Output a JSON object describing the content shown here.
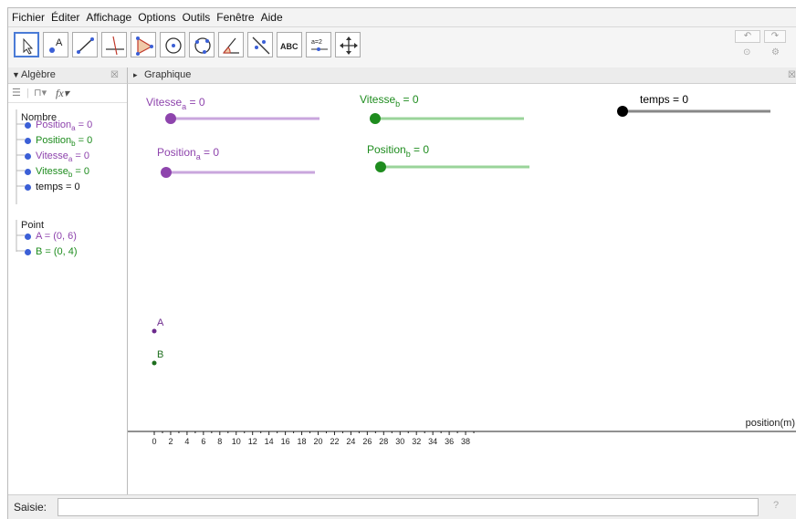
{
  "menu": [
    "Fichier",
    "Éditer",
    "Affichage",
    "Options",
    "Outils",
    "Fenêtre",
    "Aide"
  ],
  "toolbar": {
    "tools": [
      "move-tool",
      "point-tool",
      "segment-tool",
      "perpendicular-tool",
      "polygon-tool",
      "circle-tool",
      "circle-three-points-tool",
      "angle-tool",
      "reflect-tool",
      "text-tool",
      "slider-tool",
      "move-view-tool"
    ],
    "text_tool_label": "ABC",
    "slider_tool_label": "a=2",
    "undo_icon": "↶",
    "redo_icon": "↷"
  },
  "algebra": {
    "title": "Algèbre",
    "nombre_label": "Nombre",
    "point_label": "Point",
    "items": [
      {
        "base": "Position",
        "sub": "a",
        "rest": " = 0",
        "color": "#8e44ad"
      },
      {
        "base": "Position",
        "sub": "b",
        "rest": " = 0",
        "color": "#1e8c1e"
      },
      {
        "base": "Vitesse",
        "sub": "a",
        "rest": " = 0",
        "color": "#8e44ad"
      },
      {
        "base": "Vitesse",
        "sub": "b",
        "rest": " = 0",
        "color": "#1e8c1e"
      },
      {
        "base": "temps",
        "sub": "",
        "rest": " = 0",
        "color": "#111111"
      }
    ],
    "points": [
      {
        "text": "A = (0, 6)",
        "color": "#8e44ad"
      },
      {
        "text": "B = (0, 4)",
        "color": "#1e8c1e"
      }
    ]
  },
  "graphics": {
    "title": "Graphique",
    "sliders": [
      {
        "name": "Vitesse",
        "sub": "a",
        "value_text": " = 0",
        "value": 0,
        "color": "#8e44ad",
        "track": "#c9a6dd"
      },
      {
        "name": "Vitesse",
        "sub": "b",
        "value_text": " = 0",
        "value": 0,
        "color": "#1e8c1e",
        "track": "#9ad49a"
      },
      {
        "name": "temps",
        "sub": "",
        "value_text": " = 0",
        "value": 0,
        "color": "#000000",
        "track": "#888888"
      },
      {
        "name": "Position",
        "sub": "a",
        "value_text": " = 0",
        "value": 0,
        "color": "#8e44ad",
        "track": "#c9a6dd"
      },
      {
        "name": "Position",
        "sub": "b",
        "value_text": " = 0",
        "value": 0,
        "color": "#1e8c1e",
        "track": "#9ad49a"
      }
    ],
    "points": [
      {
        "label": "A",
        "color": "#6c2a8c"
      },
      {
        "label": "B",
        "color": "#1e6e1e"
      }
    ],
    "axis_label": "position(m)",
    "x_ticks": [
      "0",
      "2",
      "4",
      "6",
      "8",
      "10",
      "12",
      "14",
      "16",
      "18",
      "20",
      "22",
      "24",
      "26",
      "28",
      "30",
      "32",
      "34",
      "36",
      "38"
    ]
  },
  "input": {
    "label": "Saisie:",
    "value": "",
    "help_icon": "?"
  }
}
